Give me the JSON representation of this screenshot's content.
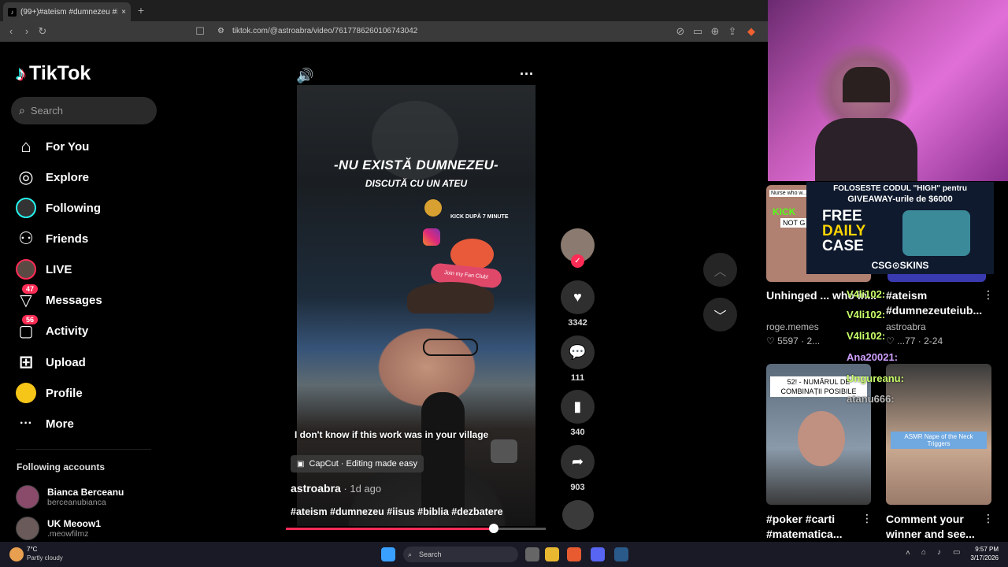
{
  "browser": {
    "tab_title": "(99+)#ateism #dumnezeu #i...",
    "tab_close": "×",
    "new_tab": "+",
    "url": "tiktok.com/@astroabra/video/7617786260106743042"
  },
  "tiktok": {
    "brand": "TikTok",
    "search_placeholder": "Search",
    "nav": [
      {
        "label": "For You",
        "icon": "⌂"
      },
      {
        "label": "Explore",
        "icon": "◎"
      },
      {
        "label": "Following",
        "icon": "●"
      },
      {
        "label": "Friends",
        "icon": "⚇"
      },
      {
        "label": "LIVE",
        "icon": "●"
      },
      {
        "label": "Messages",
        "icon": "▽",
        "badge": "47"
      },
      {
        "label": "Activity",
        "icon": "▢",
        "badge": "56"
      },
      {
        "label": "Upload",
        "icon": "⊞"
      },
      {
        "label": "Profile",
        "icon": "●"
      },
      {
        "label": "More",
        "icon": "···"
      }
    ],
    "following_title": "Following accounts",
    "accounts": [
      {
        "name": "Bianca Berceanu",
        "handle": "berceanubianca"
      },
      {
        "name": "UK Meoow1",
        ".handle": "",
        ".meow": "",
        "handle": ".meowfilmz"
      }
    ]
  },
  "video": {
    "overlay_main": "-NU EXISTĂ DUMNEZEU-",
    "overlay_sub": "DISCUTĂ CU UN ATEU",
    "kick_text": "KICK DUPĂ 7 MINUTE",
    "fan_club": "Join my Fan Club!",
    "caption": "I don't know if this work was in your village",
    "capcut": "CapCut · Editing made easy",
    "author": "astroabra",
    "ago": " · 1d ago",
    "tags": "#ateism #dumnezeu #iisus #biblia #dezbatere",
    "progress": 0.8
  },
  "actions": {
    "likes": "3342",
    "comments": "111",
    "saves": "340",
    "shares": "903",
    "like_icon": "♥",
    "comment_icon": "💬",
    "save_icon": "▮",
    "share_icon": "➦"
  },
  "overlay": {
    "ad_line1": "FOLOSESTE CODUL \"HIGH\" pentru",
    "ad_line2": "GIVEAWAY-urile de $6000",
    "ad_free": "FREE",
    "ad_daily": "DAILY",
    "ad_case": "CASE",
    "ad_brand": "CSG⊙SKINS",
    "kick": "KICK",
    "nurse": "Nurse who w... with par...",
    "chat": [
      "V4li102:",
      "V4li102:",
      "V4li102:",
      "Ana20021:",
      "Ungureanu:",
      "atanu666:"
    ],
    "combo": "52! - NUMĂRUL DE COMBINAȚII POSIBILE",
    "notg": "NOT G"
  },
  "related": [
    {
      "title": "Unhinged ... who in...",
      "author": "roge.memes",
      "meta": "♡ 5597  ·  2..."
    },
    {
      "title": "#ateism #dumnezeuteiub...",
      "author": "astroabra",
      "meta": "♡ ...77  ·  2-24"
    },
    {
      "title": "#poker #carti #matematica...",
      "author": "",
      "meta": ""
    },
    {
      "title": "Comment your winner and see...",
      "author": "",
      "meta": "",
      "thumb_text": "ASMR Nape of the Neck Triggers"
    }
  ],
  "taskbar": {
    "weather_temp": "7°C",
    "weather_desc": "Partly cloudy",
    "search": "Search",
    "time": "9:57 PM",
    "date": "3/17/2026"
  }
}
